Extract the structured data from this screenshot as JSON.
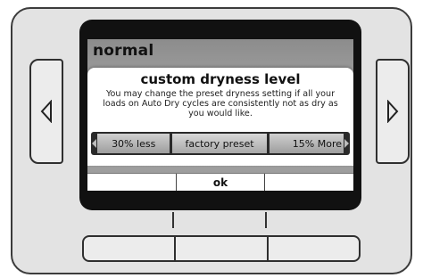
{
  "screen": {
    "title": "normal"
  },
  "dialog": {
    "title": "custom dryness level",
    "body": "You may change the preset dryness setting if all your loads on Auto Dry cycles are consistently not as dry as you would like.",
    "options": [
      "30% less",
      "factory preset",
      "15% More"
    ]
  },
  "softkeys": [
    "",
    "ok",
    ""
  ],
  "icons": {
    "left_nav": "triangle-left-icon",
    "right_nav": "triangle-right-icon"
  }
}
